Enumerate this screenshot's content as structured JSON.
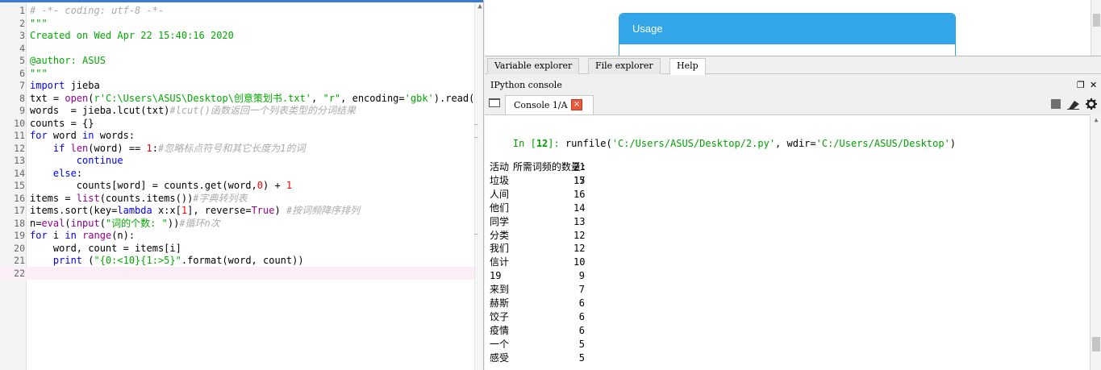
{
  "editor": {
    "lines": [
      {
        "n": "1",
        "segs": [
          {
            "t": "# -*- coding: utf-8 -*-",
            "c": "cm"
          }
        ]
      },
      {
        "n": "2",
        "segs": [
          {
            "t": "\"\"\"",
            "c": "st"
          }
        ]
      },
      {
        "n": "3",
        "segs": [
          {
            "t": "Created on Wed Apr 22 15:40:16 2020",
            "c": "st"
          }
        ]
      },
      {
        "n": "4",
        "segs": []
      },
      {
        "n": "5",
        "segs": [
          {
            "t": "@author: ASUS",
            "c": "st"
          }
        ]
      },
      {
        "n": "6",
        "segs": [
          {
            "t": "\"\"\"",
            "c": "st"
          }
        ]
      },
      {
        "n": "7",
        "segs": [
          {
            "t": "import",
            "c": "kw"
          },
          {
            "t": " jieba",
            "c": "df"
          }
        ]
      },
      {
        "n": "8",
        "segs": [
          {
            "t": "txt = ",
            "c": "df"
          },
          {
            "t": "open",
            "c": "bi"
          },
          {
            "t": "(",
            "c": "df"
          },
          {
            "t": "r'C:\\Users\\ASUS\\Desktop\\创意策划书.txt'",
            "c": "st"
          },
          {
            "t": ", ",
            "c": "df"
          },
          {
            "t": "\"r\"",
            "c": "st"
          },
          {
            "t": ", encoding=",
            "c": "df"
          },
          {
            "t": "'gbk'",
            "c": "st"
          },
          {
            "t": ").read()",
            "c": "df"
          }
        ]
      },
      {
        "n": "9",
        "segs": [
          {
            "t": "words  = jieba.lcut(txt)",
            "c": "df"
          },
          {
            "t": "#lcut()函数返回一个列表类型的分词结果",
            "c": "cm"
          }
        ]
      },
      {
        "n": "10",
        "segs": [
          {
            "t": "counts = {}",
            "c": "df"
          }
        ]
      },
      {
        "n": "11",
        "segs": [
          {
            "t": "for",
            "c": "kw"
          },
          {
            "t": " word ",
            "c": "df"
          },
          {
            "t": "in",
            "c": "kw"
          },
          {
            "t": " words:",
            "c": "df"
          }
        ]
      },
      {
        "n": "12",
        "segs": [
          {
            "t": "    ",
            "c": "df"
          },
          {
            "t": "if",
            "c": "kw"
          },
          {
            "t": " ",
            "c": "df"
          },
          {
            "t": "len",
            "c": "bi"
          },
          {
            "t": "(word) == ",
            "c": "df"
          },
          {
            "t": "1",
            "c": "nm"
          },
          {
            "t": ":",
            "c": "df"
          },
          {
            "t": "#忽略标点符号和其它长度为1的词",
            "c": "cm"
          }
        ]
      },
      {
        "n": "13",
        "segs": [
          {
            "t": "        ",
            "c": "df"
          },
          {
            "t": "continue",
            "c": "kw"
          }
        ]
      },
      {
        "n": "14",
        "segs": [
          {
            "t": "    ",
            "c": "df"
          },
          {
            "t": "else",
            "c": "kw"
          },
          {
            "t": ":",
            "c": "df"
          }
        ]
      },
      {
        "n": "15",
        "segs": [
          {
            "t": "        counts[word] = counts.get(word,",
            "c": "df"
          },
          {
            "t": "0",
            "c": "nm"
          },
          {
            "t": ") + ",
            "c": "df"
          },
          {
            "t": "1",
            "c": "nm"
          }
        ]
      },
      {
        "n": "16",
        "segs": [
          {
            "t": "items = ",
            "c": "df"
          },
          {
            "t": "list",
            "c": "bi"
          },
          {
            "t": "(counts.items())",
            "c": "df"
          },
          {
            "t": "#字典转列表",
            "c": "cm"
          }
        ]
      },
      {
        "n": "17",
        "segs": [
          {
            "t": "items.sort(key=",
            "c": "df"
          },
          {
            "t": "lambda",
            "c": "kw"
          },
          {
            "t": " x:x[",
            "c": "df"
          },
          {
            "t": "1",
            "c": "nm"
          },
          {
            "t": "], reverse=",
            "c": "df"
          },
          {
            "t": "True",
            "c": "bi"
          },
          {
            "t": ") ",
            "c": "df"
          },
          {
            "t": "#按词频降序排列",
            "c": "cm"
          }
        ]
      },
      {
        "n": "18",
        "segs": [
          {
            "t": "n=",
            "c": "df"
          },
          {
            "t": "eval",
            "c": "bi"
          },
          {
            "t": "(",
            "c": "df"
          },
          {
            "t": "input",
            "c": "bi"
          },
          {
            "t": "(",
            "c": "df"
          },
          {
            "t": "\"词的个数: \"",
            "c": "st"
          },
          {
            "t": "))",
            "c": "df"
          },
          {
            "t": "#循环n次",
            "c": "cm"
          }
        ]
      },
      {
        "n": "19",
        "segs": [
          {
            "t": "for",
            "c": "kw"
          },
          {
            "t": " i ",
            "c": "df"
          },
          {
            "t": "in",
            "c": "kw"
          },
          {
            "t": " ",
            "c": "df"
          },
          {
            "t": "range",
            "c": "bi"
          },
          {
            "t": "(n):",
            "c": "df"
          }
        ]
      },
      {
        "n": "20",
        "segs": [
          {
            "t": "    word, count = items[i]",
            "c": "df"
          }
        ]
      },
      {
        "n": "21",
        "segs": [
          {
            "t": "    ",
            "c": "df"
          },
          {
            "t": "print",
            "c": "kw"
          },
          {
            "t": " (",
            "c": "df"
          },
          {
            "t": "\"{0:<10}{1:>5}\"",
            "c": "st"
          },
          {
            "t": ".format(word, count))",
            "c": "df"
          }
        ]
      },
      {
        "n": "22",
        "segs": []
      }
    ]
  },
  "help": {
    "usage_title": "Usage"
  },
  "pane_tabs": [
    "Variable explorer",
    "File explorer",
    "Help"
  ],
  "console": {
    "pane_title": "IPython console",
    "tab_label": "Console 1/A",
    "tab_close": "×",
    "prompt_prefix": "In [",
    "prompt_number": "12",
    "prompt_suffix": "]: ",
    "command_fn": "runfile(",
    "command_path": "'C:/Users/ASUS/Desktop/2.py'",
    "command_mid": ", wdir=",
    "command_wdir": "'C:/Users/ASUS/Desktop'",
    "command_end": ")",
    "input_label": "所需词频的数量:",
    "input_value": "15",
    "output": [
      {
        "word": "活动",
        "count": "21"
      },
      {
        "word": "垃圾",
        "count": "17"
      },
      {
        "word": "人间",
        "count": "16"
      },
      {
        "word": "他们",
        "count": "14"
      },
      {
        "word": "同学",
        "count": "13"
      },
      {
        "word": "分类",
        "count": "12"
      },
      {
        "word": "我们",
        "count": "12"
      },
      {
        "word": "信计",
        "count": "10"
      },
      {
        "word": "19",
        "count": "9"
      },
      {
        "word": "来到",
        "count": "7"
      },
      {
        "word": "赫斯",
        "count": "6"
      },
      {
        "word": "饺子",
        "count": "6"
      },
      {
        "word": "疫情",
        "count": "6"
      },
      {
        "word": "一个",
        "count": "5"
      },
      {
        "word": "感受",
        "count": "5"
      }
    ]
  },
  "icons": {
    "undock": "❐",
    "close": "✕",
    "stop": "■",
    "clear": "eraser-icon",
    "settings": "⚙"
  }
}
